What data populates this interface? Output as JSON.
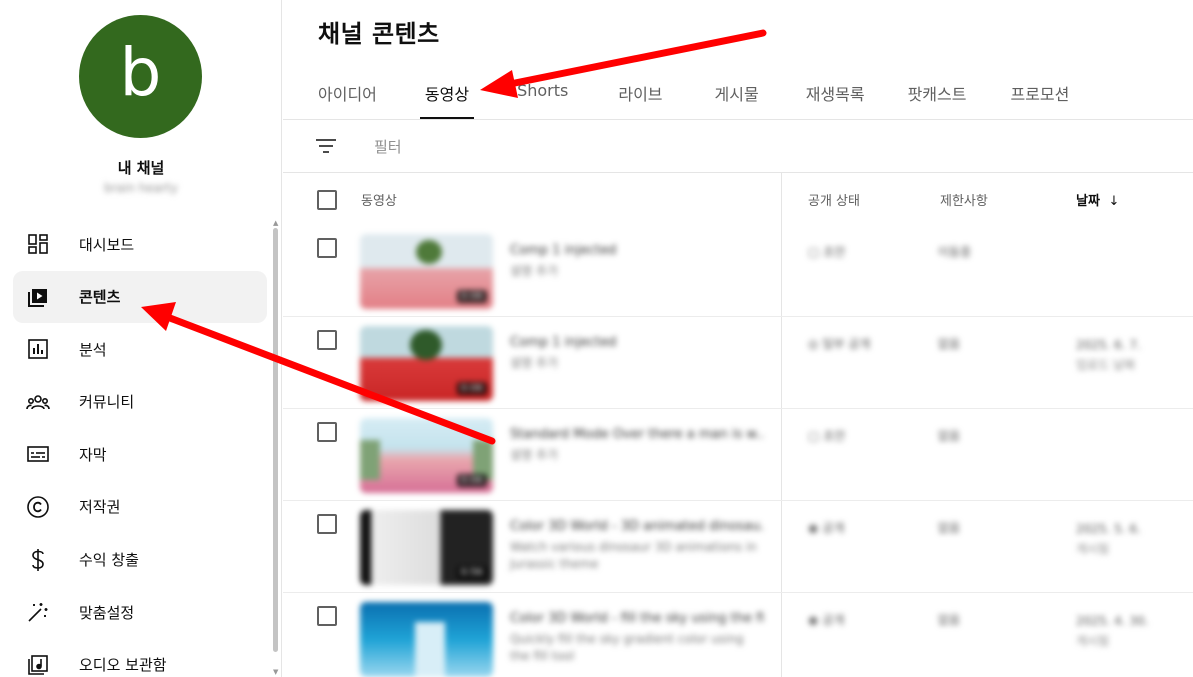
{
  "sidebar": {
    "avatar_letter": "b",
    "avatar_color": "#33691e",
    "channel_name": "내 채널",
    "channel_handle": "brain hearty",
    "items": [
      {
        "label": "대시보드",
        "icon": "dashboard-icon",
        "active": false
      },
      {
        "label": "콘텐츠",
        "icon": "content-icon",
        "active": true
      },
      {
        "label": "분석",
        "icon": "analytics-icon",
        "active": false
      },
      {
        "label": "커뮤니티",
        "icon": "community-icon",
        "active": false
      },
      {
        "label": "자막",
        "icon": "subtitles-icon",
        "active": false
      },
      {
        "label": "저작권",
        "icon": "copyright-icon",
        "active": false
      },
      {
        "label": "수익 창출",
        "icon": "dollar-icon",
        "active": false
      },
      {
        "label": "맞춤설정",
        "icon": "magic-wand-icon",
        "active": false
      },
      {
        "label": "오디오 보관함",
        "icon": "audio-library-icon",
        "active": false
      }
    ]
  },
  "main": {
    "title": "채널 콘텐츠",
    "tabs": [
      {
        "label": "아이디어",
        "active": false
      },
      {
        "label": "동영상",
        "active": true
      },
      {
        "label": "Shorts",
        "active": false
      },
      {
        "label": "라이브",
        "active": false
      },
      {
        "label": "게시물",
        "active": false
      },
      {
        "label": "재생목록",
        "active": false
      },
      {
        "label": "팟캐스트",
        "active": false
      },
      {
        "label": "프로모션",
        "active": false
      }
    ],
    "filter_placeholder": "필터",
    "columns": {
      "video": "동영상",
      "visibility": "공개 상태",
      "restrictions": "제한사항",
      "date": "날짜",
      "date_sort": "↓"
    },
    "rows": [
      {
        "title": "Comp 1 injected",
        "desc": "설명 추가",
        "duration": "0:06",
        "visibility": "초안",
        "restrictions": "이동중",
        "date": "",
        "date_sub": ""
      },
      {
        "title": "Comp 1 injected",
        "desc": "설명 추가",
        "duration": "0:06",
        "visibility": "일부 공개",
        "restrictions": "없음",
        "date": "2025. 6. 7.",
        "date_sub": "업로드 날짜"
      },
      {
        "title": "Standard Mode Over there a man is w...",
        "desc": "설명 추가",
        "duration": "0:06",
        "visibility": "초안",
        "restrictions": "없음",
        "date": "",
        "date_sub": ""
      },
      {
        "title": "Color 3D World - 3D animated dinosau...",
        "desc": "Watch various dinosaur 3D animations in Jurassic theme",
        "duration": "0:56",
        "visibility": "공개",
        "restrictions": "없음",
        "date": "2025. 5. 6.",
        "date_sub": "게시됨"
      },
      {
        "title": "Color 3D World - fill the sky using the fi...",
        "desc": "Quickly fill the sky gradient color using the fill tool",
        "duration": "",
        "visibility": "공개",
        "restrictions": "없음",
        "date": "2025. 4. 30.",
        "date_sub": "게시됨"
      }
    ]
  },
  "annotations": {
    "arrow_color": "#ff0000"
  }
}
